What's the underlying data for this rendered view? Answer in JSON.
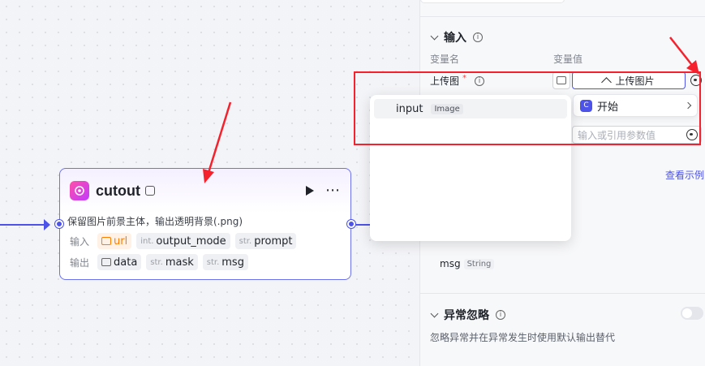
{
  "node": {
    "title": "cutout",
    "description": "保留图片前景主体，输出透明背景(.png)",
    "input_label": "输入",
    "output_label": "输出",
    "inputs": [
      {
        "type": "img",
        "name": "url"
      },
      {
        "type": "int.",
        "name": "output_mode"
      },
      {
        "type": "str.",
        "name": "prompt"
      }
    ],
    "outputs": [
      {
        "type": "img",
        "name": "data"
      },
      {
        "type": "str.",
        "name": "mask"
      },
      {
        "type": "str.",
        "name": "msg"
      }
    ]
  },
  "panel": {
    "input_section": "输入",
    "col_name": "变量名",
    "col_value": "变量值",
    "var_label": "上传图",
    "required_mark": "*",
    "upload_button": "上传图片",
    "start_item": "开始",
    "start_icon": "C",
    "ref_placeholder": "输入或引用参数值",
    "example_link": "查看示例",
    "output_name": "msg",
    "output_type": "String",
    "ignore_section": "异常忽略",
    "ignore_desc": "忽略异常并在异常发生时使用默认输出替代"
  },
  "dropdown": {
    "item_name": "input",
    "item_type": "Image"
  },
  "colors": {
    "accent": "#4d53e8",
    "annotation": "#f5222d",
    "warn": "#ff7d00"
  }
}
